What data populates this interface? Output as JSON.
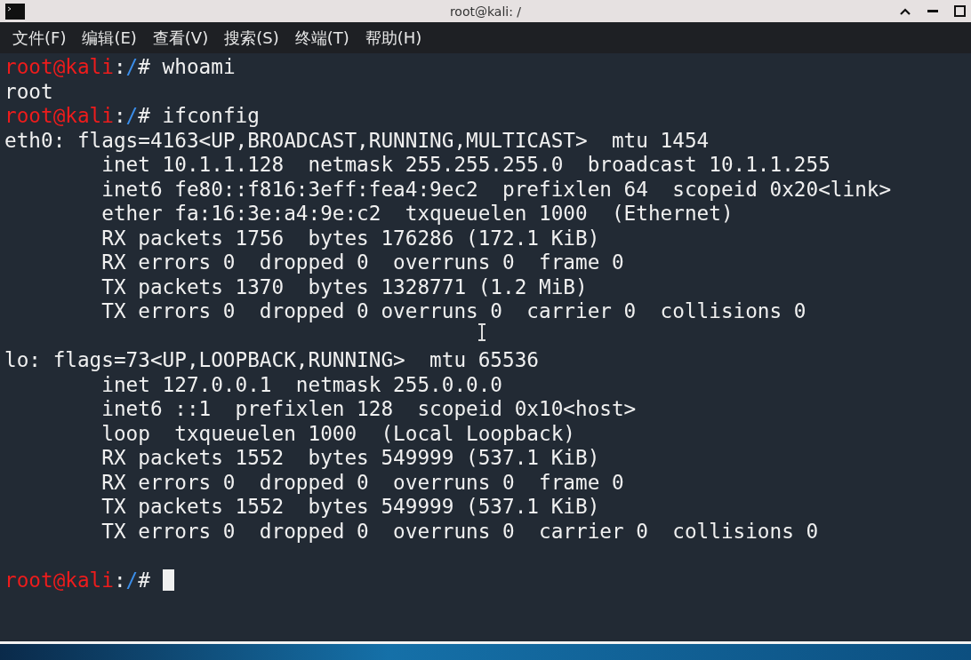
{
  "window": {
    "title": "root@kali: /"
  },
  "menu": [
    "文件(F)",
    "编辑(E)",
    "查看(V)",
    "搜索(S)",
    "终端(T)",
    "帮助(H)"
  ],
  "terminal": {
    "lines": [
      {
        "kind": "prompt",
        "user_host": "root@kali",
        "separator": ":",
        "path": "/",
        "symbol": "#",
        "command": "whoami",
        "cursor": false
      },
      {
        "kind": "output",
        "text": "root"
      },
      {
        "kind": "prompt",
        "user_host": "root@kali",
        "separator": ":",
        "path": "/",
        "symbol": "#",
        "command": "ifconfig",
        "cursor": false
      },
      {
        "kind": "output",
        "text": "eth0: flags=4163<UP,BROADCAST,RUNNING,MULTICAST>  mtu 1454"
      },
      {
        "kind": "output",
        "text": "        inet 10.1.1.128  netmask 255.255.255.0  broadcast 10.1.1.255"
      },
      {
        "kind": "output",
        "text": "        inet6 fe80::f816:3eff:fea4:9ec2  prefixlen 64  scopeid 0x20<link>"
      },
      {
        "kind": "output",
        "text": "        ether fa:16:3e:a4:9e:c2  txqueuelen 1000  (Ethernet)"
      },
      {
        "kind": "output",
        "text": "        RX packets 1756  bytes 176286 (172.1 KiB)"
      },
      {
        "kind": "output",
        "text": "        RX errors 0  dropped 0  overruns 0  frame 0"
      },
      {
        "kind": "output",
        "text": "        TX packets 1370  bytes 1328771 (1.2 MiB)"
      },
      {
        "kind": "output",
        "text": "        TX errors 0  dropped 0 overruns 0  carrier 0  collisions 0"
      },
      {
        "kind": "blank"
      },
      {
        "kind": "output",
        "text": "lo: flags=73<UP,LOOPBACK,RUNNING>  mtu 65536"
      },
      {
        "kind": "output",
        "text": "        inet 127.0.0.1  netmask 255.0.0.0"
      },
      {
        "kind": "output",
        "text": "        inet6 ::1  prefixlen 128  scopeid 0x10<host>"
      },
      {
        "kind": "output",
        "text": "        loop  txqueuelen 1000  (Local Loopback)"
      },
      {
        "kind": "output",
        "text": "        RX packets 1552  bytes 549999 (537.1 KiB)"
      },
      {
        "kind": "output",
        "text": "        RX errors 0  dropped 0  overruns 0  frame 0"
      },
      {
        "kind": "output",
        "text": "        TX packets 1552  bytes 549999 (537.1 KiB)"
      },
      {
        "kind": "output",
        "text": "        TX errors 0  dropped 0  overruns 0  carrier 0  collisions 0"
      },
      {
        "kind": "blank"
      },
      {
        "kind": "prompt",
        "user_host": "root@kali",
        "separator": ":",
        "path": "/",
        "symbol": "#",
        "cursor": true
      }
    ]
  }
}
